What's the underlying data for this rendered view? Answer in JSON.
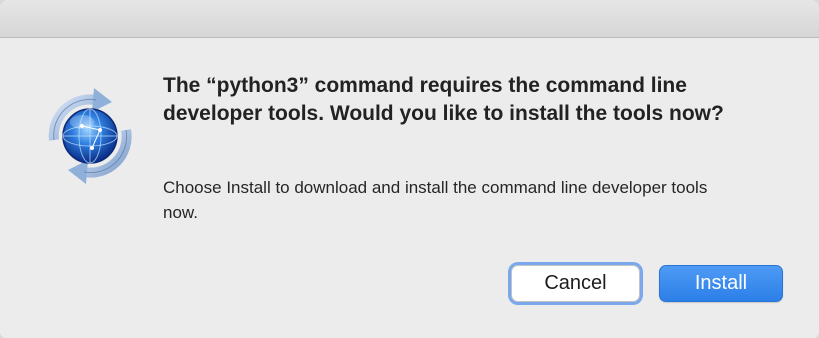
{
  "dialog": {
    "headline": "The “python3” command requires the command line developer tools. Would you like to install the tools now?",
    "body": "Choose Install to download and install the command line developer tools now.",
    "icon": "software-update-globe-icon"
  },
  "buttons": {
    "cancel_label": "Cancel",
    "install_label": "Install"
  },
  "colors": {
    "window_bg": "#ececec",
    "accent": "#2c7fe8",
    "focus_ring": "#79a9ec",
    "text": "#222222"
  }
}
